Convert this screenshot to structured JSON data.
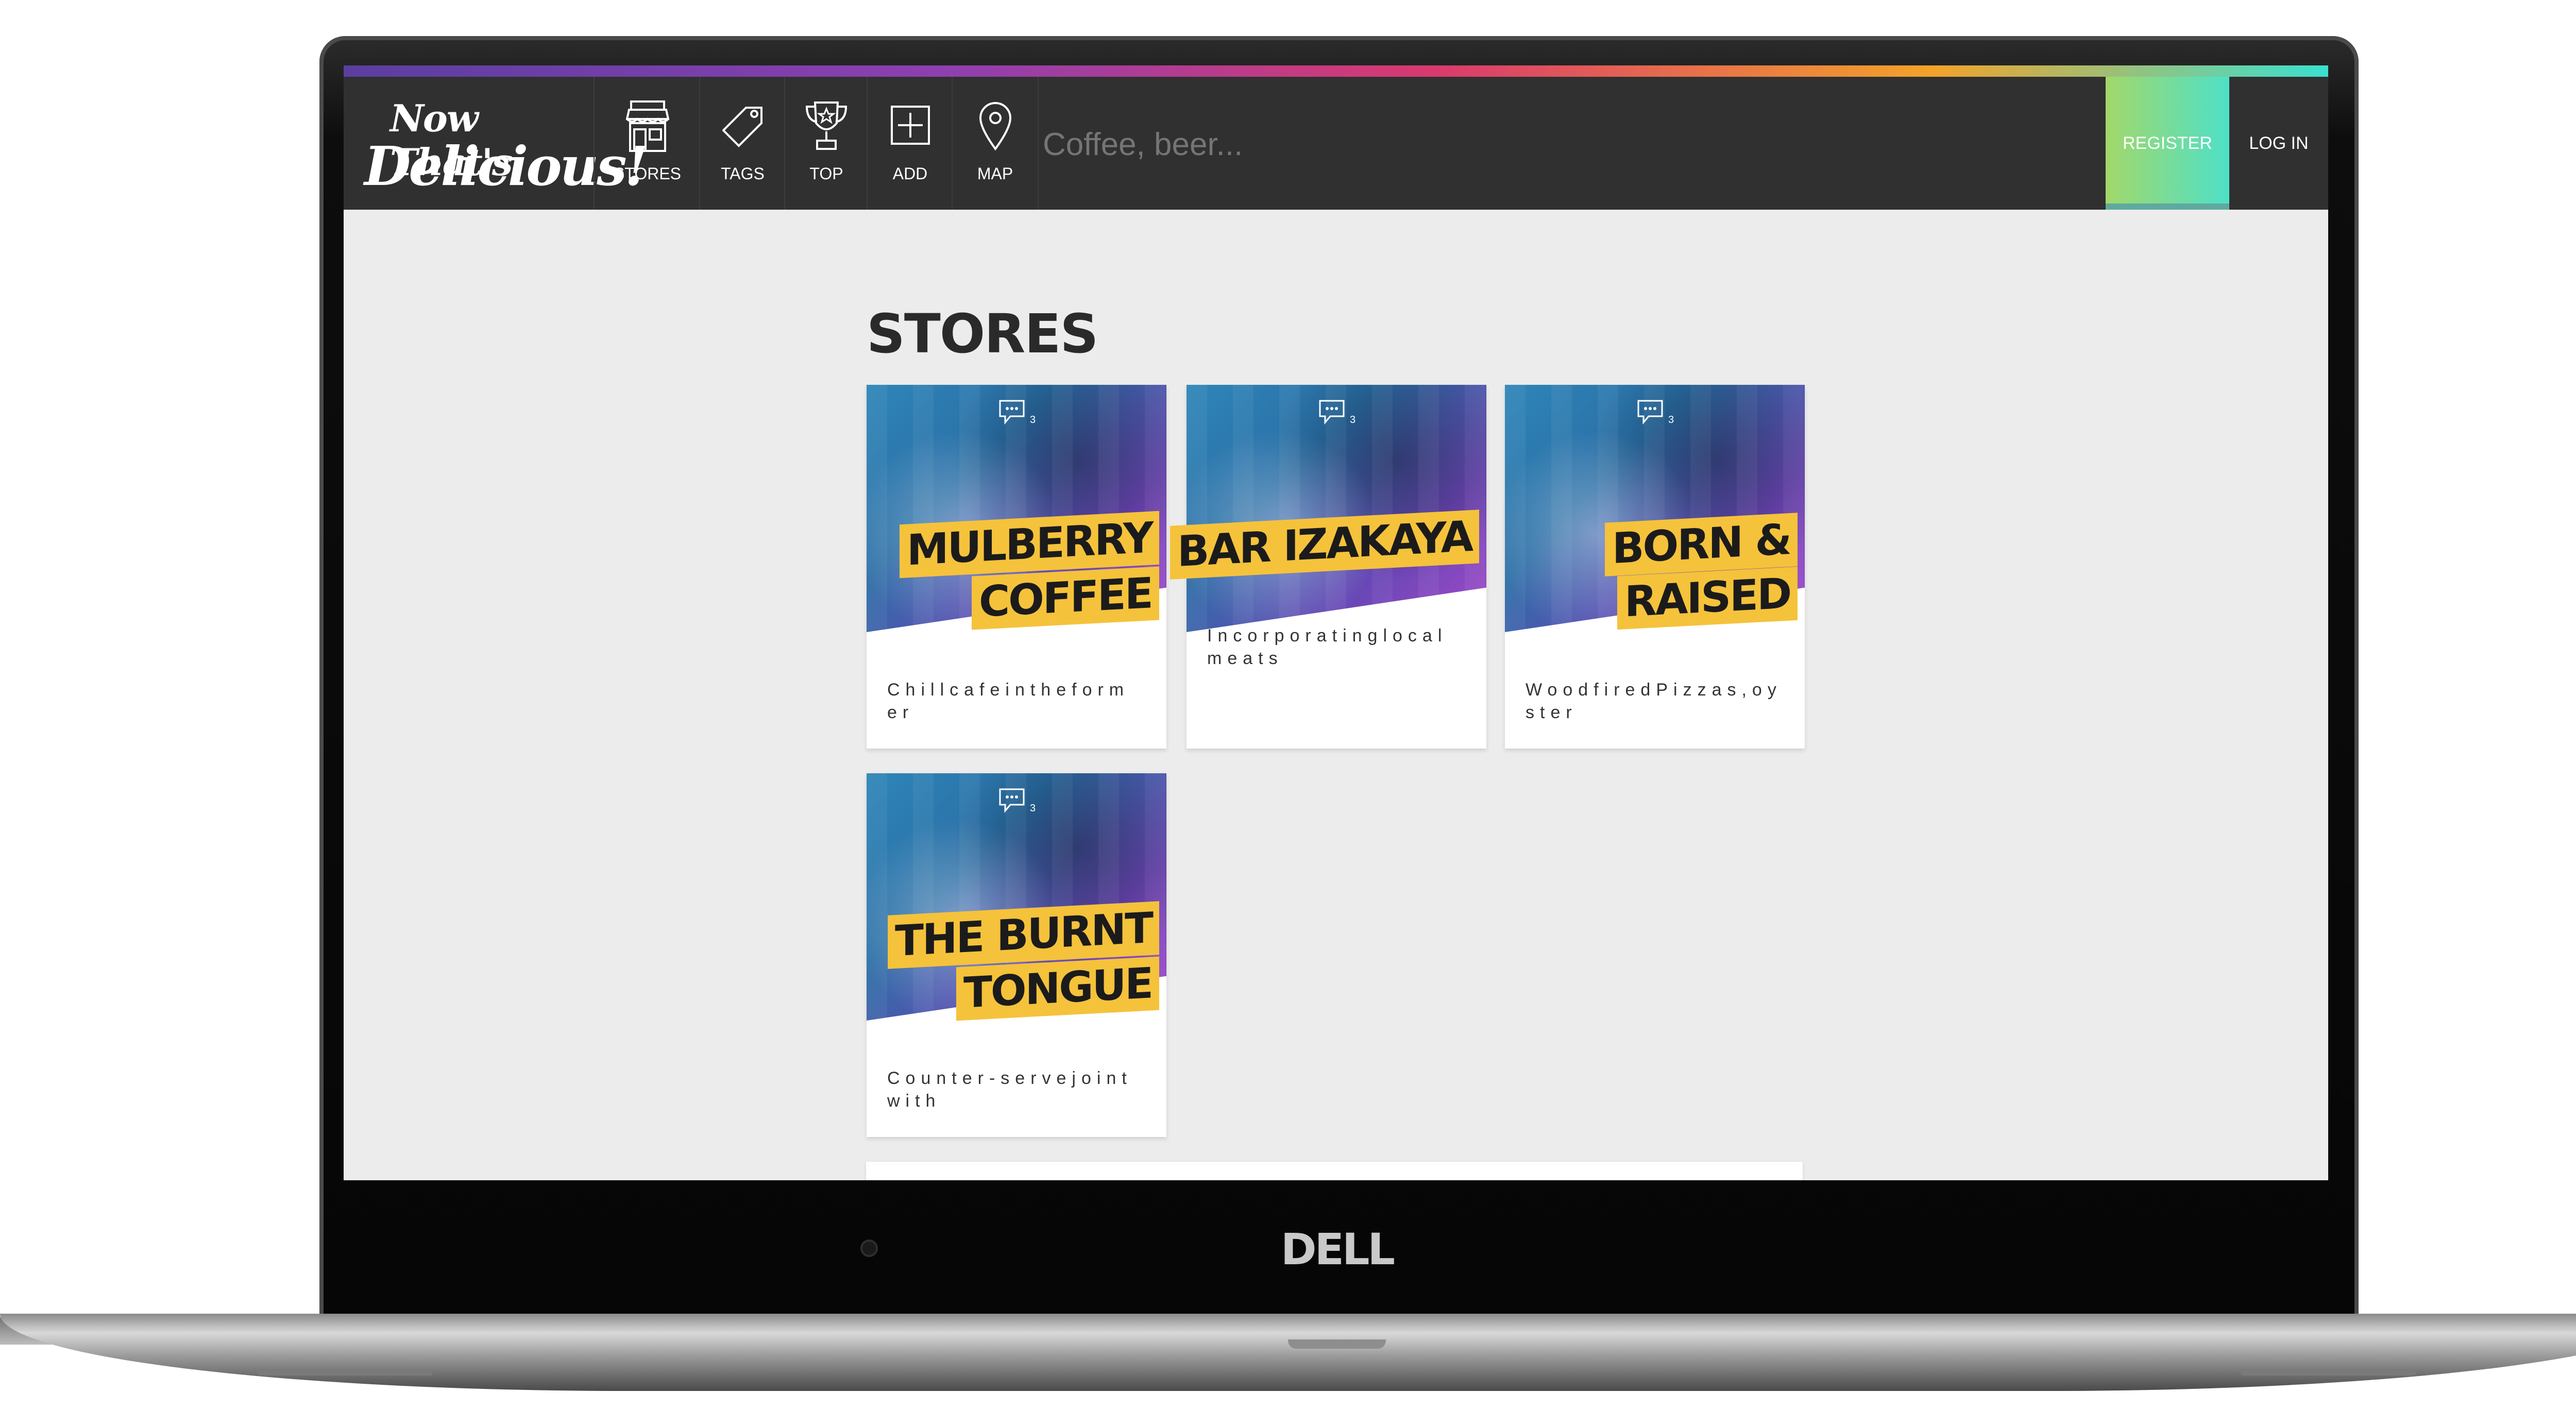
{
  "nav": {
    "logo_line1": "Now That's",
    "logo_line2": "Delicious!",
    "items": [
      {
        "label": "STORES",
        "icon": "store-icon"
      },
      {
        "label": "TAGS",
        "icon": "tag-icon"
      },
      {
        "label": "TOP",
        "icon": "trophy-icon"
      },
      {
        "label": "ADD",
        "icon": "add-icon"
      },
      {
        "label": "MAP",
        "icon": "map-pin-icon"
      }
    ],
    "search_placeholder": "Coffee, beer...",
    "register_label": "REGISTER",
    "login_label": "LOG IN"
  },
  "main": {
    "title": "STORES",
    "stores": [
      {
        "name_line1": "MULBERRY",
        "name_line2": "COFFEE",
        "comments": "3",
        "description": "Chillcafeintheformer"
      },
      {
        "name_line1": "BAR IZAKAYA",
        "name_line2": "",
        "comments": "3",
        "description": "Incorporatinglocalmeats"
      },
      {
        "name_line1": "BORN &",
        "name_line2": "RAISED",
        "comments": "3",
        "description": "WoodfiredPizzas,oyster"
      },
      {
        "name_line1": "THE BURNT",
        "name_line2": "TONGUE",
        "comments": "3",
        "description": "Counter-servejointwith"
      }
    ]
  },
  "device": {
    "brand": "DELL"
  },
  "colors": {
    "nav_bg": "#303030",
    "accent_yellow": "#f5c23b",
    "page_bg": "#ececec"
  }
}
